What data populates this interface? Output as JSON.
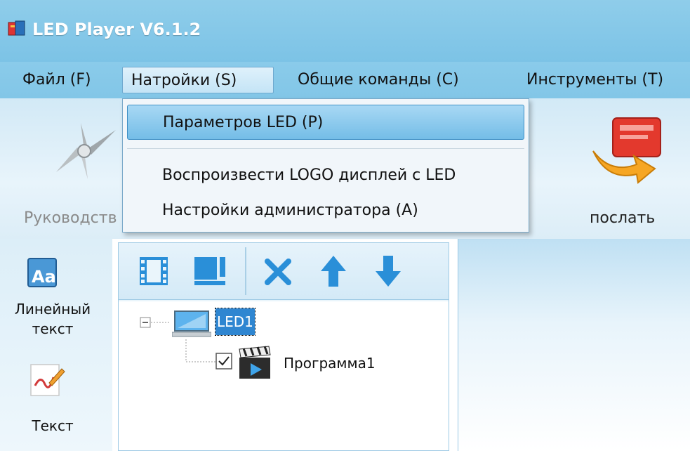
{
  "window": {
    "title": "LED Player V6.1.2",
    "icon": "app-icon"
  },
  "menu": {
    "items": [
      {
        "label": "Файл (F)"
      },
      {
        "label": "Натройки (S)"
      },
      {
        "label": "Общие команды (C)"
      },
      {
        "label": "Инструменты (T)"
      }
    ],
    "active_index": 1
  },
  "toolbar": {
    "guide_label": "Руководств",
    "send_label": "послать"
  },
  "dropdown": {
    "items": [
      {
        "label": "Параметров LED (P)"
      },
      {
        "label": "Воспроизвести LOGO дисплей с LED"
      },
      {
        "label": "Настройки администратора (A)"
      }
    ],
    "highlighted_index": 0
  },
  "left_tools": {
    "line_text_label_1": "Линейный",
    "line_text_label_2": "текст",
    "text_label": "Текст"
  },
  "tree": {
    "root_label": "LED1",
    "child_label": "Программа1",
    "child_checked": true
  },
  "colors": {
    "title_bar": "#7cc3e6",
    "highlight": "#74bde7",
    "icon_blue": "#2a8fd8"
  }
}
